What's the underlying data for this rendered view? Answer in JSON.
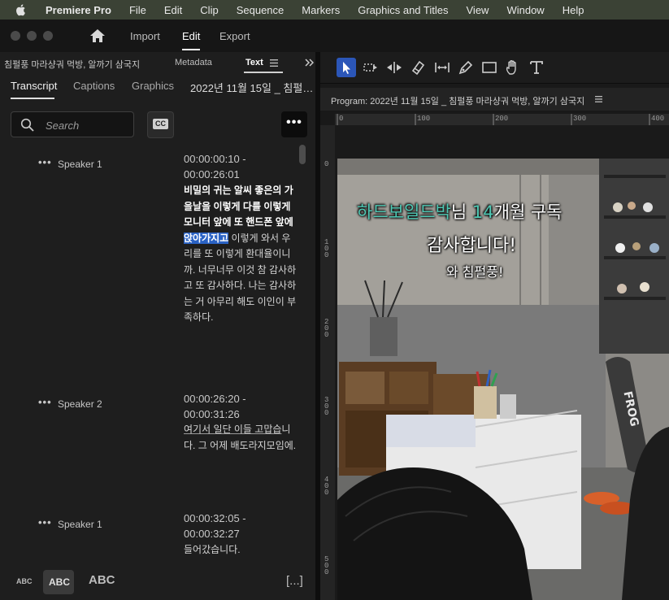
{
  "menubar": {
    "app_name": "Premiere Pro",
    "items": [
      "File",
      "Edit",
      "Clip",
      "Sequence",
      "Markers",
      "Graphics and Titles",
      "View",
      "Window",
      "Help"
    ]
  },
  "workspace": {
    "tabs": [
      "Import",
      "Edit",
      "Export"
    ],
    "active": "Edit"
  },
  "left_panel": {
    "header": {
      "clip_title": "침펄풍 마라샹궈 먹방, 알까기 삼국지",
      "metadata_tab": "Metadata",
      "text_tab": "Text"
    },
    "tabs": {
      "transcript": "Transcript",
      "captions": "Captions",
      "graphics": "Graphics",
      "sequence_title": "2022년 11월 15일 _ 침펄…"
    },
    "search": {
      "placeholder": "Search",
      "value": ""
    },
    "cc_label": "CC",
    "more_label": "•••",
    "segments": [
      {
        "speaker": "Speaker 1",
        "time_start": "00:00:00:10 -",
        "time_end": "00:00:26:01",
        "text_bold": "비밀의 귀는 알씨 좋은의 가을날을 이렇게 다를 이렇게 모니터 앞에 또 핸드폰 앞에 ",
        "text_highlight": "앉아가지고",
        "text_rest": " 이렇게 와서 우리를 또 이렇게 환대율이니까. 너무너무 이것 참 감사하고 또 감사하다. 나는 감사하는 거 아무리 해도 이인이 부족하다."
      },
      {
        "speaker": "Speaker 2",
        "time_start": "00:00:26:20 -",
        "time_end": "00:00:31:26",
        "text_underlined": "여기서 일단 이들 고맙습",
        "text_rest": "니다. 그 어제 배도라지모임에."
      },
      {
        "speaker": "Speaker 1",
        "time_start": "00:00:32:05 -",
        "time_end": "00:00:32:27",
        "text": "들어갔습니다."
      }
    ],
    "footer": {
      "abc_small": "ABC",
      "abc_medium": "ABC",
      "abc_large": "ABC",
      "bracket": "[...]"
    }
  },
  "program_monitor": {
    "title": "Program: 2022년 11월 15일 _ 침펄풍 마라샹궈 먹방, 알까기 삼국지",
    "ruler_top": [
      "0",
      "100",
      "200",
      "300",
      "400"
    ],
    "ruler_left": [
      "0",
      "1 0 0",
      "2 0 0",
      "3 0 0",
      "4 0 0",
      "5 0 0"
    ],
    "caption": {
      "highlight_name": "하드보일드박",
      "suffix_1": "님 ",
      "months": "14",
      "suffix_2": "개월 구독",
      "line2": "감사합니다!",
      "line3": "와 침펄풍!"
    },
    "skateboard_text": "FROG"
  },
  "colors": {
    "accent_blue": "#2a62c4",
    "caption_teal": "#4fc8b4",
    "menubar_bg": "#3b4235"
  }
}
